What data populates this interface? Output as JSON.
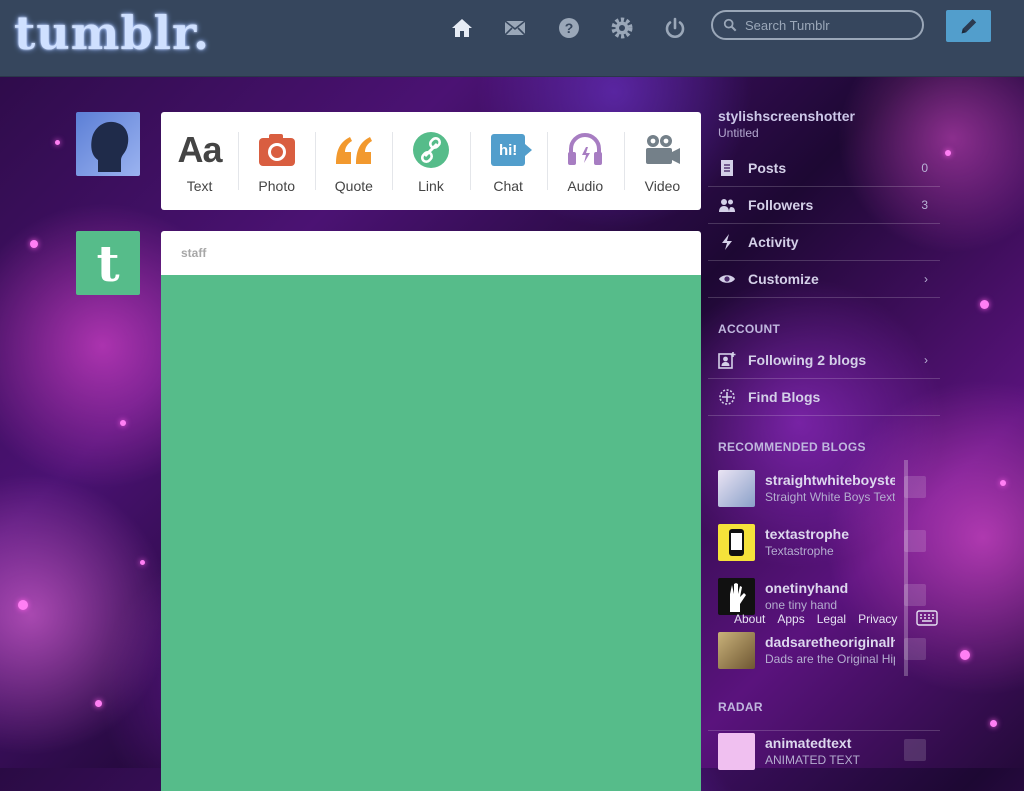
{
  "header": {
    "logo": "tumblr.",
    "search_placeholder": "Search Tumblr"
  },
  "composer": {
    "types": [
      {
        "key": "text",
        "label": "Text",
        "icon": "text-icon",
        "color": "#444444"
      },
      {
        "key": "photo",
        "label": "Photo",
        "icon": "camera-icon",
        "color": "#d95e40"
      },
      {
        "key": "quote",
        "label": "Quote",
        "icon": "quote-icon",
        "color": "#f2992e"
      },
      {
        "key": "link",
        "label": "Link",
        "icon": "link-icon",
        "color": "#56bc8a"
      },
      {
        "key": "chat",
        "label": "Chat",
        "icon": "chat-icon",
        "color": "#529ecc"
      },
      {
        "key": "audio",
        "label": "Audio",
        "icon": "headphones-icon",
        "color": "#a77dc2"
      },
      {
        "key": "video",
        "label": "Video",
        "icon": "video-camera-icon",
        "color": "#748089"
      }
    ],
    "text_icon_glyph": "Aa",
    "chat_icon_glyph": "hi!"
  },
  "post": {
    "blog_name": "staff",
    "accent": "#56bc8a"
  },
  "sidebar": {
    "blog_name": "stylishscreenshotter",
    "blog_title": "Untitled",
    "nav": [
      {
        "label": "Posts",
        "count": "0",
        "icon": "document-icon"
      },
      {
        "label": "Followers",
        "count": "3",
        "icon": "people-icon"
      },
      {
        "label": "Activity",
        "count": "",
        "icon": "lightning-icon"
      },
      {
        "label": "Customize",
        "count": "›",
        "icon": "eye-icon"
      }
    ],
    "account_heading": "ACCOUNT",
    "account": [
      {
        "label": "Following 2 blogs",
        "count": "›",
        "icon": "add-person-icon"
      },
      {
        "label": "Find Blogs",
        "count": "",
        "icon": "compass-icon"
      }
    ],
    "recommended_heading": "RECOMMENDED BLOGS",
    "recommended": [
      {
        "name": "straightwhiteboystextingyou",
        "subtitle": "Straight White Boys Texting",
        "thumb": "#d9d2e8"
      },
      {
        "name": "textastrophe",
        "subtitle": "Textastrophe",
        "thumb": "#f5e23a"
      },
      {
        "name": "onetinyhand",
        "subtitle": "one tiny hand",
        "thumb": "#111111"
      },
      {
        "name": "dadsaretheoriginalhipster",
        "subtitle": "Dads are the Original Hipster",
        "thumb": "#b79a63"
      }
    ],
    "footer_links": [
      "About",
      "Apps",
      "Legal",
      "Privacy"
    ],
    "radar_heading": "RADAR",
    "radar": {
      "name": "animatedtext",
      "subtitle": "ANIMATED TEXT",
      "thumb": "#f0c0f0"
    }
  }
}
